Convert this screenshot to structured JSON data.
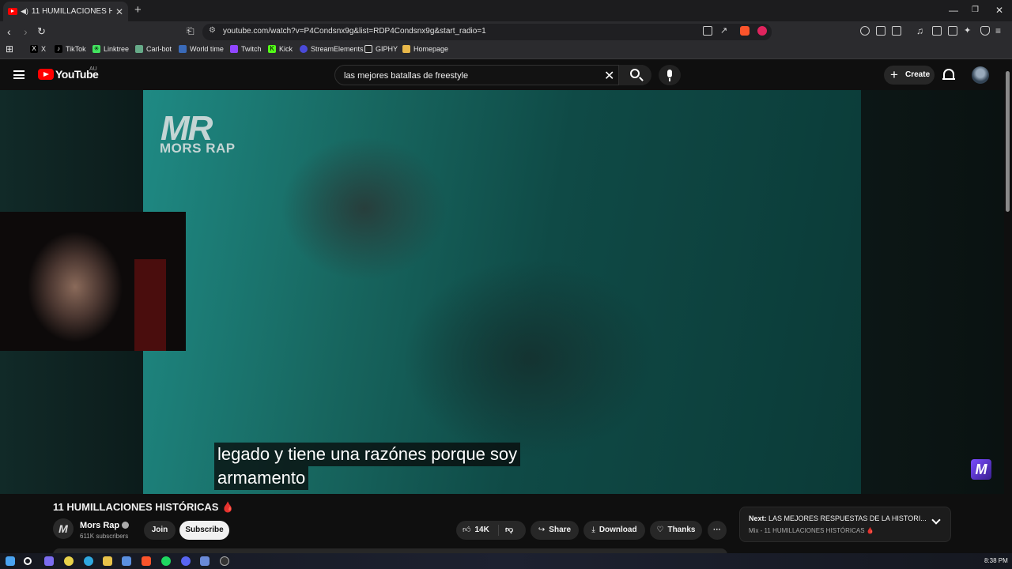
{
  "browser": {
    "tab_title": "11 HUMILLACIONES HISTÓRI",
    "url": "youtube.com/watch?v=P4Condsnx9g&list=RDP4Condsnx9g&start_radio=1",
    "bookmarks": [
      "X",
      "TikTok",
      "Linktree",
      "Carl-bot",
      "World time",
      "Twitch",
      "Kick",
      "StreamElements",
      "GIPHY",
      "Homepage"
    ]
  },
  "youtube": {
    "logo_text": "YouTube",
    "region": "AU",
    "search_query": "las mejores batallas de freestyle",
    "create_label": "Create"
  },
  "video": {
    "channel_watermark": "MR",
    "channel_watermark_sub": "MORS RAP",
    "subtitle_line1": "legado y tiene una razónes porque soy",
    "subtitle_line2": "armamento",
    "corner_badge": "M"
  },
  "info": {
    "title": "11 HUMILLACIONES HISTÓRICAS 🩸",
    "channel_name": "Mors Rap",
    "subscribers": "611K subscribers",
    "join_label": "Join",
    "subscribe_label": "Subscribe",
    "likes": "14K",
    "share_label": "Share",
    "download_label": "Download",
    "thanks_label": "Thanks",
    "more_label": "···"
  },
  "next": {
    "prefix": "Next:",
    "title": "LAS MEJORES RESPUESTAS DE LA HISTORI...",
    "mix": "Mix - 11 HUMILLACIONES HISTÓRICAS 🩸"
  },
  "taskbar": {
    "time": "8:38 PM"
  },
  "colors": {
    "youtube_red": "#ff0000",
    "background": "#0f0f0f",
    "video_teal": "#1f8a84"
  }
}
